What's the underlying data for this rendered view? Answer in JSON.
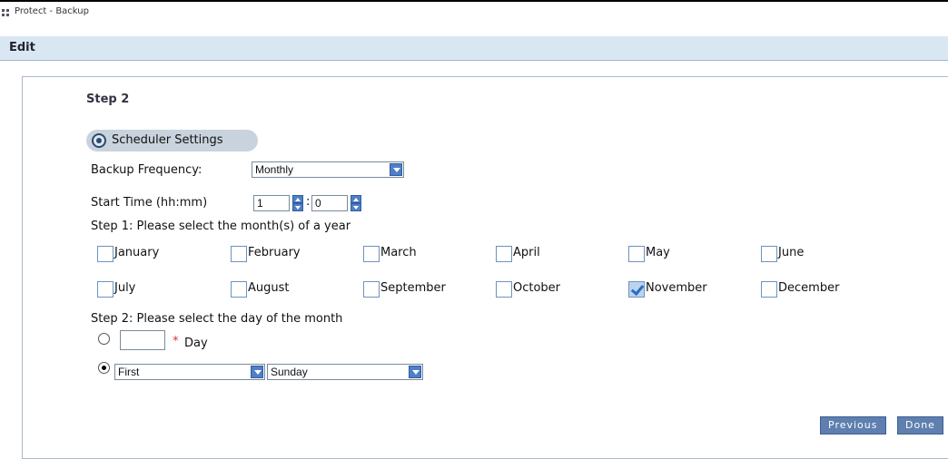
{
  "window": {
    "title": "Protect - Backup"
  },
  "edit_bar": {
    "label": "Edit"
  },
  "step2": {
    "title": "Step 2"
  },
  "scheduler": {
    "label": "Scheduler Settings"
  },
  "backup_frequency": {
    "label": "Backup Frequency:",
    "value": "Monthly"
  },
  "start_time": {
    "label": "Start Time (hh:mm)",
    "hour": "1",
    "separator": ":",
    "minute": "0"
  },
  "months_prompt": "Step 1: Please select the month(s) of a year",
  "months": [
    {
      "label": "January",
      "checked": false
    },
    {
      "label": "February",
      "checked": false
    },
    {
      "label": "March",
      "checked": false
    },
    {
      "label": "April",
      "checked": false
    },
    {
      "label": "May",
      "checked": false
    },
    {
      "label": "June",
      "checked": false
    },
    {
      "label": "July",
      "checked": false
    },
    {
      "label": "August",
      "checked": false
    },
    {
      "label": "September",
      "checked": false
    },
    {
      "label": "October",
      "checked": false
    },
    {
      "label": "November",
      "checked": true
    },
    {
      "label": "December",
      "checked": false
    }
  ],
  "day_prompt": "Step 2: Please select the day of the month",
  "day_option": {
    "value": "",
    "required_mark": "*",
    "label": "Day",
    "selected": false
  },
  "weekday_option": {
    "selected": true,
    "ordinal": "First",
    "weekday": "Sunday"
  },
  "buttons": {
    "previous": "Previous",
    "done": "Done"
  },
  "colors": {
    "accent": "#5e7fb0",
    "edit_bar": "#d9e7f3",
    "required": "#e03030"
  }
}
